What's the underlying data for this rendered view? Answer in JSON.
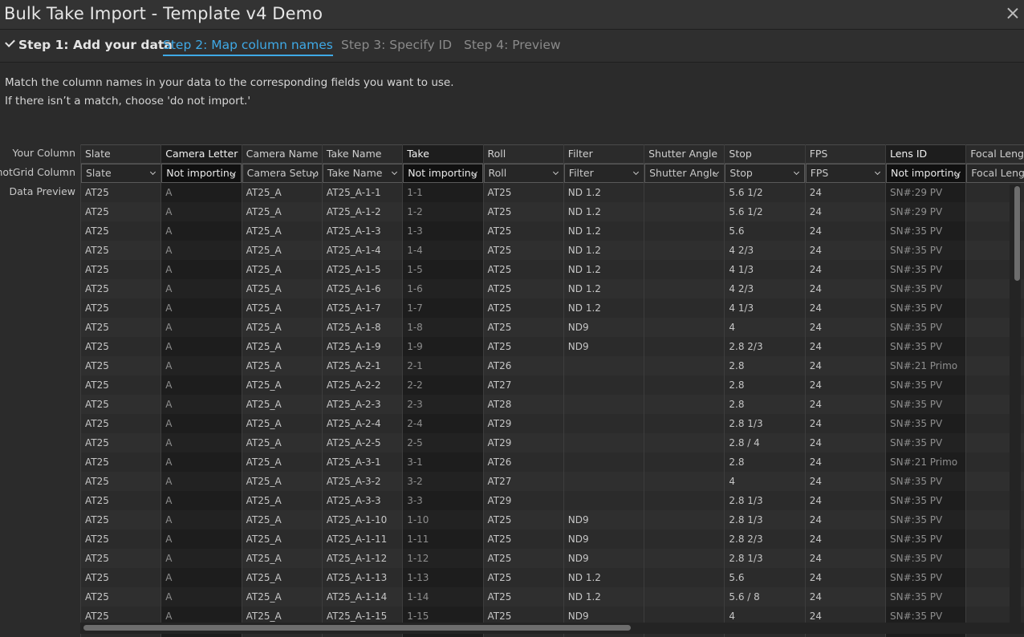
{
  "window": {
    "title": "Bulk Take Import - Template v4 Demo"
  },
  "steps": [
    "Step 1: Add your data",
    "Step 2: Map column names",
    "Step 3: Specify ID",
    "Step 4: Preview"
  ],
  "instructions": [
    "Match the column names in your data to the corresponding fields you want to use.",
    "If there isn’t a match, choose 'do not import.'"
  ],
  "row_labels": {
    "your_column": "Your Column",
    "shotgrid_column": "ShotGrid Column",
    "data_preview": "Data Preview"
  },
  "columns": [
    {
      "name": "Slate",
      "mapping": "Slate",
      "not_importing": false
    },
    {
      "name": "Camera Letter",
      "mapping": "Not importing",
      "not_importing": true
    },
    {
      "name": "Camera Name",
      "mapping": "Camera Setup",
      "not_importing": false
    },
    {
      "name": "Take Name",
      "mapping": "Take Name",
      "not_importing": false
    },
    {
      "name": "Take",
      "mapping": "Not importing",
      "not_importing": true
    },
    {
      "name": "Roll",
      "mapping": "Roll",
      "not_importing": false
    },
    {
      "name": "Filter",
      "mapping": "Filter",
      "not_importing": false
    },
    {
      "name": "Shutter Angle",
      "mapping": "Shutter Angle",
      "not_importing": false
    },
    {
      "name": "Stop",
      "mapping": "Stop",
      "not_importing": false
    },
    {
      "name": "FPS",
      "mapping": "FPS",
      "not_importing": false
    },
    {
      "name": "Lens ID",
      "mapping": "Not importing",
      "not_importing": true
    },
    {
      "name": "Focal Length",
      "mapping": "Focal Length",
      "not_importing": false
    }
  ],
  "rows": [
    [
      "AT25",
      "A",
      "AT25_A",
      "AT25_A-1-1",
      "1-1",
      "AT25",
      "ND 1.2",
      "",
      "5.6 1/2",
      "24",
      "SN#:29 PV",
      ""
    ],
    [
      "AT25",
      "A",
      "AT25_A",
      "AT25_A-1-2",
      "1-2",
      "AT25",
      "ND 1.2",
      "",
      "5.6 1/2",
      "24",
      "SN#:29 PV",
      ""
    ],
    [
      "AT25",
      "A",
      "AT25_A",
      "AT25_A-1-3",
      "1-3",
      "AT25",
      "ND 1.2",
      "",
      "5.6",
      "24",
      "SN#:35 PV",
      ""
    ],
    [
      "AT25",
      "A",
      "AT25_A",
      "AT25_A-1-4",
      "1-4",
      "AT25",
      "ND 1.2",
      "",
      "4 2/3",
      "24",
      "SN#:35 PV",
      ""
    ],
    [
      "AT25",
      "A",
      "AT25_A",
      "AT25_A-1-5",
      "1-5",
      "AT25",
      "ND 1.2",
      "",
      "4 1/3",
      "24",
      "SN#:35 PV",
      ""
    ],
    [
      "AT25",
      "A",
      "AT25_A",
      "AT25_A-1-6",
      "1-6",
      "AT25",
      "ND 1.2",
      "",
      "4 2/3",
      "24",
      "SN#:35 PV",
      ""
    ],
    [
      "AT25",
      "A",
      "AT25_A",
      "AT25_A-1-7",
      "1-7",
      "AT25",
      "ND 1.2",
      "",
      "4 1/3",
      "24",
      "SN#:35 PV",
      ""
    ],
    [
      "AT25",
      "A",
      "AT25_A",
      "AT25_A-1-8",
      "1-8",
      "AT25",
      "ND9",
      "",
      "4",
      "24",
      "SN#:35 PV",
      ""
    ],
    [
      "AT25",
      "A",
      "AT25_A",
      "AT25_A-1-9",
      "1-9",
      "AT25",
      "ND9",
      "",
      "2.8 2/3",
      "24",
      "SN#:35 PV",
      ""
    ],
    [
      "AT25",
      "A",
      "AT25_A",
      "AT25_A-2-1",
      "2-1",
      "AT26",
      "",
      "",
      "2.8",
      "24",
      "SN#:21 Primo",
      ""
    ],
    [
      "AT25",
      "A",
      "AT25_A",
      "AT25_A-2-2",
      "2-2",
      "AT27",
      "",
      "",
      "2.8",
      "24",
      "SN#:35 PV",
      ""
    ],
    [
      "AT25",
      "A",
      "AT25_A",
      "AT25_A-2-3",
      "2-3",
      "AT28",
      "",
      "",
      "2.8",
      "24",
      "SN#:35 PV",
      ""
    ],
    [
      "AT25",
      "A",
      "AT25_A",
      "AT25_A-2-4",
      "2-4",
      "AT29",
      "",
      "",
      "2.8 1/3",
      "24",
      "SN#:35 PV",
      ""
    ],
    [
      "AT25",
      "A",
      "AT25_A",
      "AT25_A-2-5",
      "2-5",
      "AT29",
      "",
      "",
      "2.8 / 4",
      "24",
      "SN#:35 PV",
      ""
    ],
    [
      "AT25",
      "A",
      "AT25_A",
      "AT25_A-3-1",
      "3-1",
      "AT26",
      "",
      "",
      "2.8",
      "24",
      "SN#:21 Primo",
      ""
    ],
    [
      "AT25",
      "A",
      "AT25_A",
      "AT25_A-3-2",
      "3-2",
      "AT27",
      "",
      "",
      "4",
      "24",
      "SN#:35 PV",
      ""
    ],
    [
      "AT25",
      "A",
      "AT25_A",
      "AT25_A-3-3",
      "3-3",
      "AT29",
      "",
      "",
      "2.8 1/3",
      "24",
      "SN#:35 PV",
      ""
    ],
    [
      "AT25",
      "A",
      "AT25_A",
      "AT25_A-1-10",
      "1-10",
      "AT25",
      "ND9",
      "",
      "2.8 1/3",
      "24",
      "SN#:35 PV",
      ""
    ],
    [
      "AT25",
      "A",
      "AT25_A",
      "AT25_A-1-11",
      "1-11",
      "AT25",
      "ND9",
      "",
      "2.8 2/3",
      "24",
      "SN#:35 PV",
      ""
    ],
    [
      "AT25",
      "A",
      "AT25_A",
      "AT25_A-1-12",
      "1-12",
      "AT25",
      "ND9",
      "",
      "2.8 1/3",
      "24",
      "SN#:35 PV",
      ""
    ],
    [
      "AT25",
      "A",
      "AT25_A",
      "AT25_A-1-13",
      "1-13",
      "AT25",
      "ND 1.2",
      "",
      "5.6",
      "24",
      "SN#:35 PV",
      ""
    ],
    [
      "AT25",
      "A",
      "AT25_A",
      "AT25_A-1-14",
      "1-14",
      "AT25",
      "ND 1.2",
      "",
      "5.6 / 8",
      "24",
      "SN#:35 PV",
      ""
    ],
    [
      "AT25",
      "A",
      "AT25_A",
      "AT25_A-1-15",
      "1-15",
      "AT25",
      "ND9",
      "",
      "4",
      "24",
      "SN#:35 PV",
      ""
    ]
  ]
}
